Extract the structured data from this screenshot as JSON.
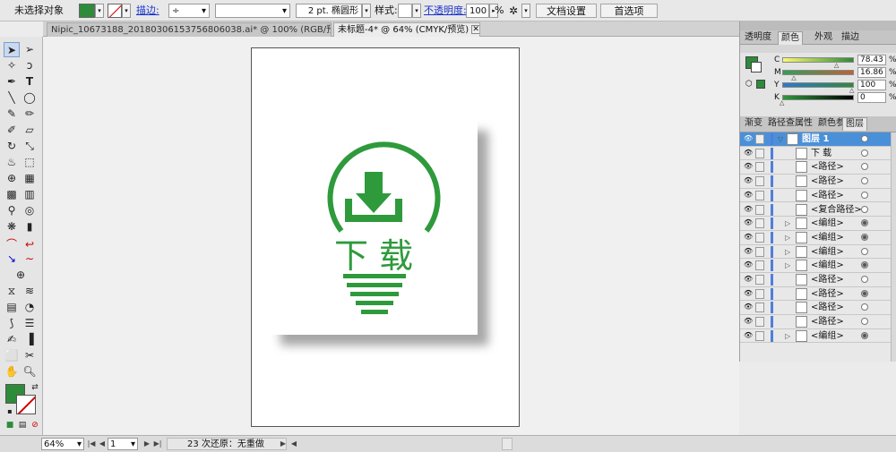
{
  "control_bar": {
    "selection_label": "未选择对象",
    "stroke_label": "描边:",
    "brush_value": "2 pt. 椭圆形",
    "style_label": "样式:",
    "opacity_label": "不透明度:",
    "opacity_value": "100",
    "opacity_unit": "%",
    "doc_setup_button": "文档设置",
    "preferences_button": "首选项",
    "fill_color": "#2e8b3a"
  },
  "tabs": [
    {
      "label": "Nipic_10673188_20180306153756806038.ai* @ 100% (RGB/预览)",
      "active": false
    },
    {
      "label": "未标题-4* @ 64% (CMYK/预览)",
      "active": true
    }
  ],
  "toolbox": {
    "tools": [
      "selection-tool",
      "direct-selection-tool",
      "magic-wand-tool",
      "lasso-tool",
      "pen-tool",
      "type-tool",
      "line-tool",
      "rectangle-tool",
      "paintbrush-tool",
      "pencil-tool",
      "blob-brush-tool",
      "eraser-tool",
      "rotate-tool",
      "scale-tool",
      "warp-tool",
      "free-transform-tool",
      "shape-builder-tool",
      "perspective-tool",
      "mesh-tool",
      "gradient-tool",
      "eyedropper-tool",
      "blend-tool",
      "symbol-sprayer-tool",
      "column-graph-tool",
      "artboard-tool",
      "slice-tool",
      "hand-tool",
      "zoom-tool"
    ],
    "fill_color": "#2e8b3a"
  },
  "artwork": {
    "text": "下 载",
    "brand_color": "#2e9a3c"
  },
  "color_panel": {
    "tabs": [
      "透明度",
      "颜色",
      "外观",
      "描边"
    ],
    "active_tab": "颜色",
    "channels": [
      {
        "label": "C",
        "value": "78.43",
        "fraction": 0.78
      },
      {
        "label": "M",
        "value": "16.86",
        "fraction": 0.17
      },
      {
        "label": "Y",
        "value": "100",
        "fraction": 1.0
      },
      {
        "label": "K",
        "value": "0",
        "fraction": 0.0
      }
    ],
    "percent": "%"
  },
  "layers_panel": {
    "tabs": [
      "渐变",
      "路径查",
      "属性",
      "颜色参",
      "图层"
    ],
    "active_tab": "图层",
    "rows": [
      {
        "name": "图层 1",
        "selected": true,
        "expand": "▽",
        "indent": 0,
        "filled_target": false
      },
      {
        "name": "下 载",
        "selected": false,
        "expand": "",
        "indent": 1,
        "filled_target": false
      },
      {
        "name": "<路径>",
        "selected": false,
        "expand": "",
        "indent": 1,
        "filled_target": false
      },
      {
        "name": "<路径>",
        "selected": false,
        "expand": "",
        "indent": 1,
        "filled_target": false
      },
      {
        "name": "<路径>",
        "selected": false,
        "expand": "",
        "indent": 1,
        "filled_target": false
      },
      {
        "name": "<复合路径>",
        "selected": false,
        "expand": "",
        "indent": 1,
        "filled_target": false
      },
      {
        "name": "<编组>",
        "selected": false,
        "expand": "▷",
        "indent": 1,
        "filled_target": true
      },
      {
        "name": "<编组>",
        "selected": false,
        "expand": "▷",
        "indent": 1,
        "filled_target": true
      },
      {
        "name": "<编组>",
        "selected": false,
        "expand": "▷",
        "indent": 1,
        "filled_target": false
      },
      {
        "name": "<编组>",
        "selected": false,
        "expand": "▷",
        "indent": 1,
        "filled_target": true
      },
      {
        "name": "<路径>",
        "selected": false,
        "expand": "",
        "indent": 1,
        "filled_target": false
      },
      {
        "name": "<路径>",
        "selected": false,
        "expand": "",
        "indent": 1,
        "filled_target": true
      },
      {
        "name": "<路径>",
        "selected": false,
        "expand": "",
        "indent": 1,
        "filled_target": false
      },
      {
        "name": "<路径>",
        "selected": false,
        "expand": "",
        "indent": 1,
        "filled_target": false
      },
      {
        "name": "<编组>",
        "selected": false,
        "expand": "▷",
        "indent": 1,
        "filled_target": true
      }
    ]
  },
  "status_bar": {
    "zoom": "64%",
    "artboard_number": "1",
    "status_text": "23 次还原：无重做"
  }
}
